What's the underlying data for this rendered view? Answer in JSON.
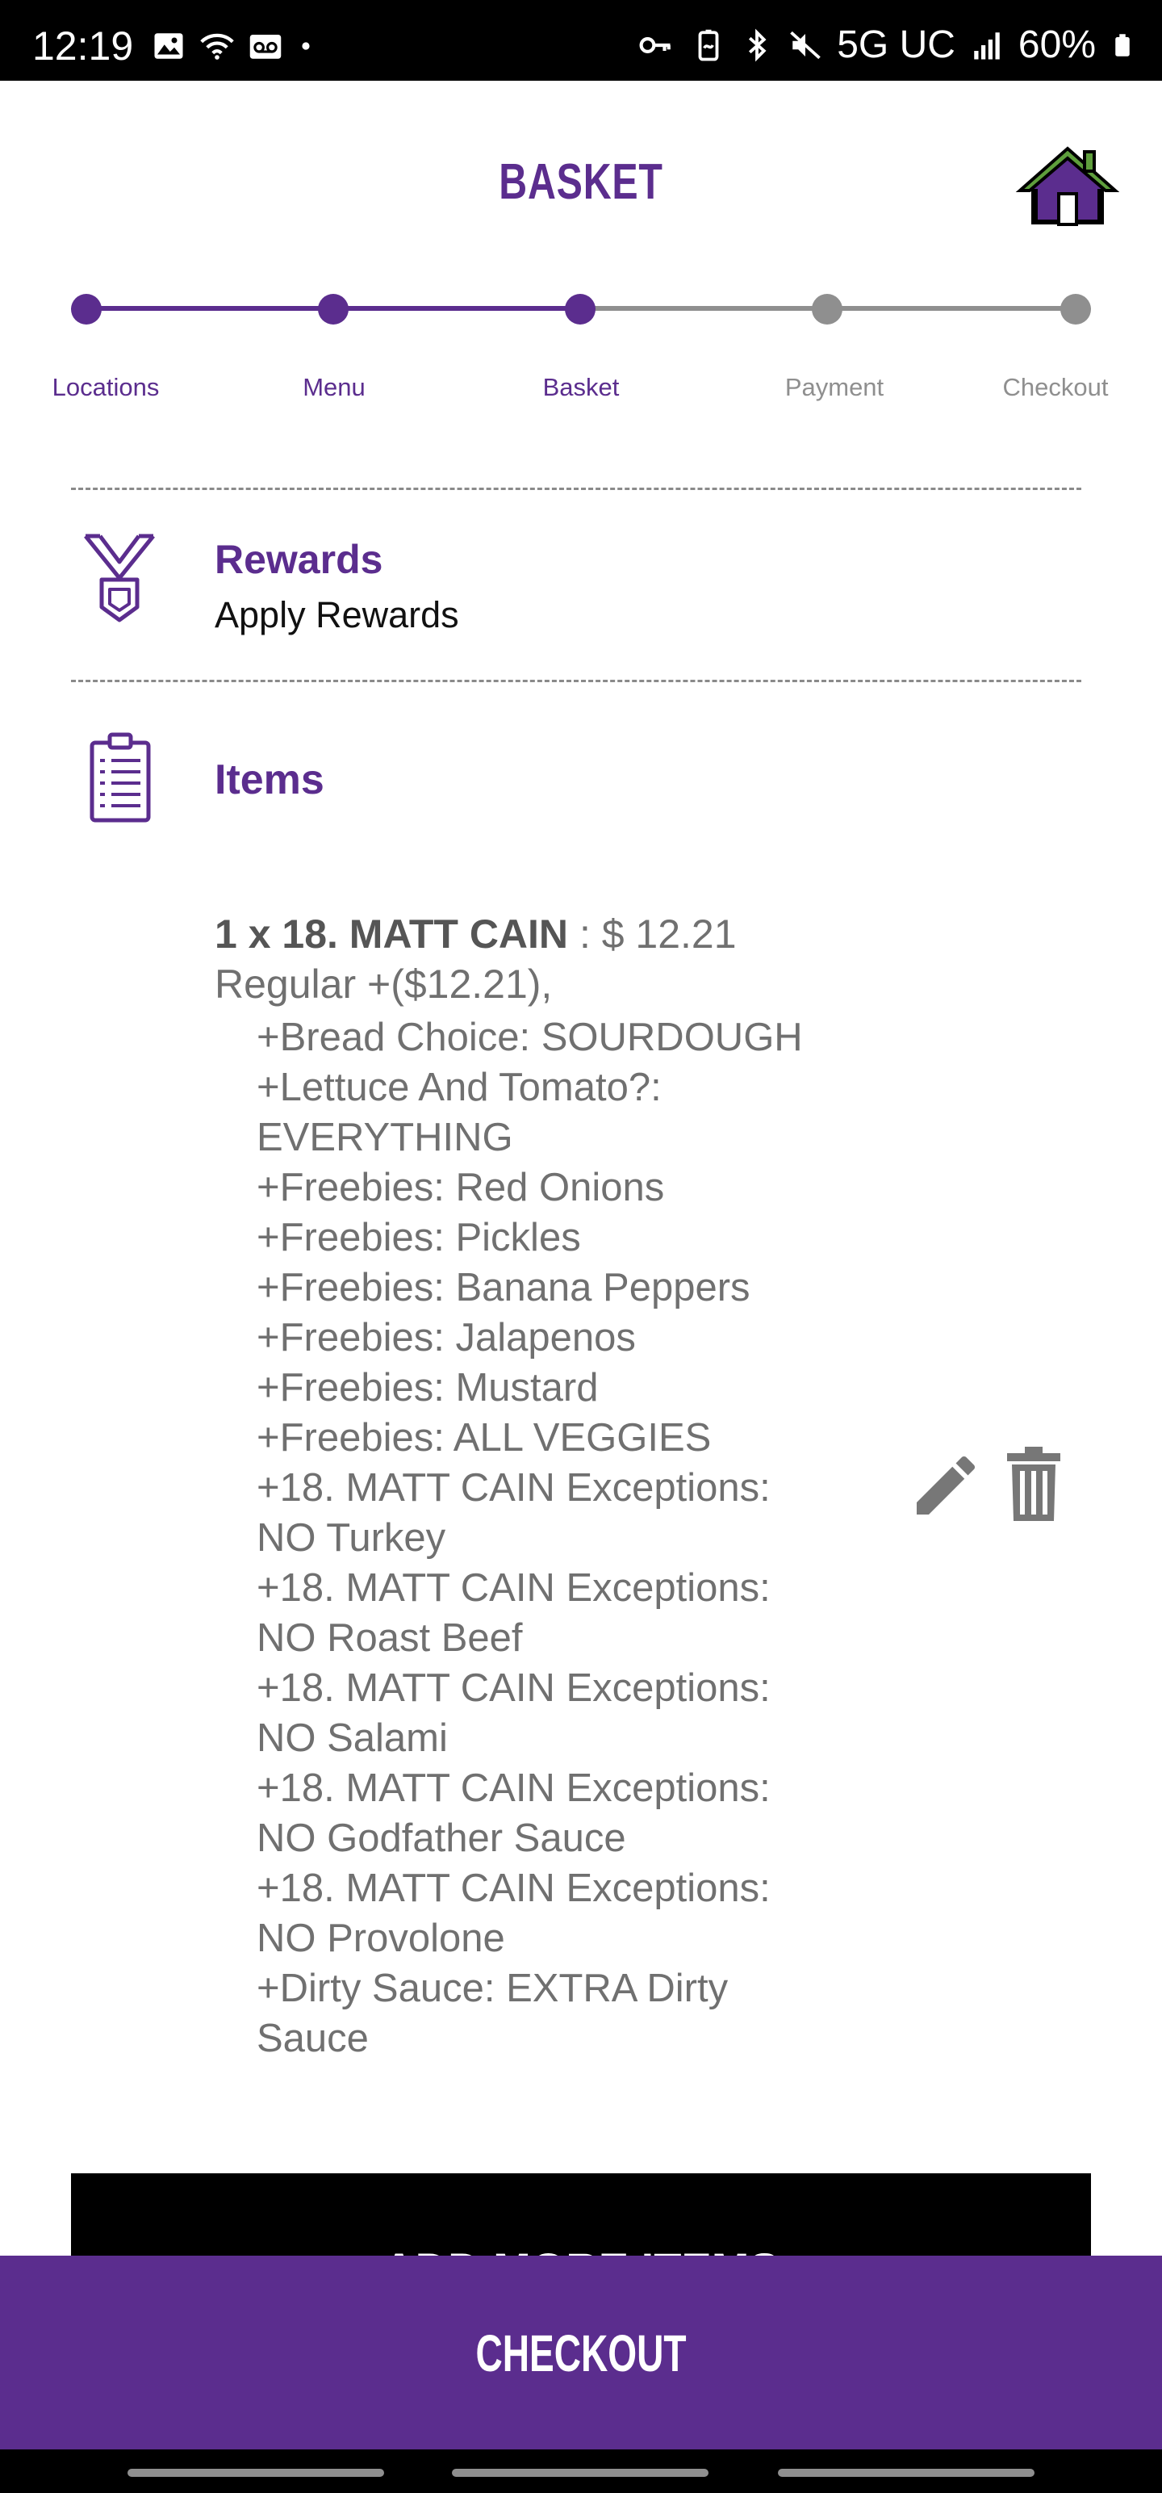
{
  "status_bar": {
    "time": "12:19",
    "network": "5G UC",
    "battery": "60%"
  },
  "header": {
    "title": "BASKET",
    "home_icon": "home-icon"
  },
  "progress": {
    "steps": [
      {
        "label": "Locations",
        "state": "done"
      },
      {
        "label": "Menu",
        "state": "done"
      },
      {
        "label": "Basket",
        "state": "current"
      },
      {
        "label": "Payment",
        "state": "pending"
      },
      {
        "label": "Checkout",
        "state": "pending"
      }
    ]
  },
  "rewards": {
    "title": "Rewards",
    "subtitle": "Apply Rewards"
  },
  "items": {
    "title": "Items",
    "entries": [
      {
        "name": "1 x 18. MATT CAIN",
        "price": " : $ 12.21",
        "size": "Regular +($12.21),",
        "modifiers": [
          "+Bread Choice: SOURDOUGH",
          "+Lettuce And Tomato?:\nEVERYTHING",
          "+Freebies: Red Onions",
          "+Freebies: Pickles",
          "+Freebies: Banana Peppers",
          "+Freebies: Jalapenos",
          "+Freebies: Mustard",
          "+Freebies: ALL VEGGIES",
          "+18. MATT CAIN Exceptions:\nNO Turkey",
          "+18. MATT CAIN Exceptions:\nNO Roast Beef",
          "+18. MATT CAIN Exceptions:\nNO Salami",
          "+18. MATT CAIN Exceptions:\nNO Godfather Sauce",
          "+18. MATT CAIN Exceptions:\nNO Provolone",
          "+Dirty Sauce: EXTRA Dirty\nSauce"
        ]
      }
    ]
  },
  "add_more_label": "ADD MORE ITEMS",
  "checkout_label": "CHECKOUT",
  "colors": {
    "brand_purple": "#5b2d8e",
    "inactive_gray": "#8f8f8f",
    "text_gray": "#707070"
  }
}
